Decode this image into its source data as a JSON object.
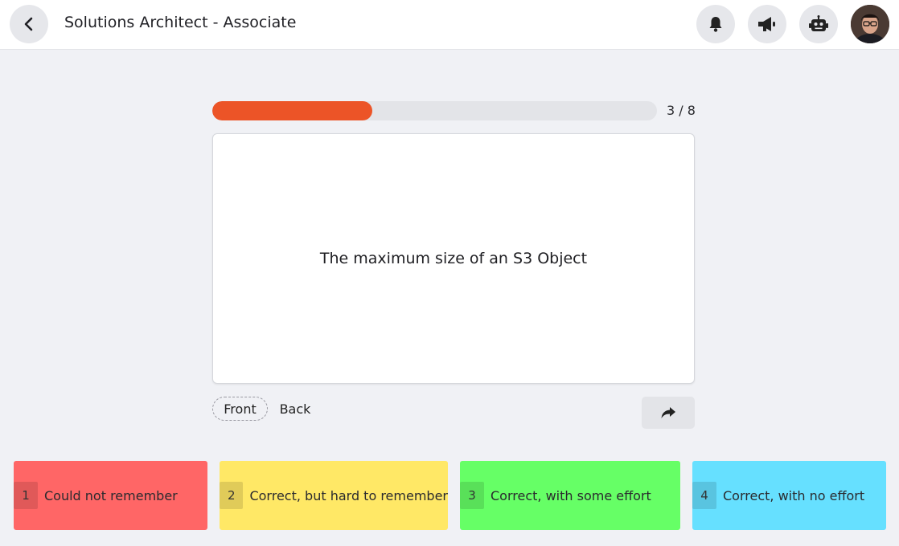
{
  "header": {
    "title": "Solutions Architect - Associate",
    "icons": [
      "back-arrow-icon",
      "bell-icon",
      "megaphone-icon",
      "robot-icon",
      "user-avatar"
    ]
  },
  "progress": {
    "current": 3,
    "total": 8,
    "label": "3 / 8",
    "fill_fraction": 0.36,
    "color": "#ec5427"
  },
  "card": {
    "text": "The maximum size of an S3 Object"
  },
  "sides": {
    "front": "Front",
    "back": "Back",
    "active": "front"
  },
  "ratings": [
    {
      "number": "1",
      "label": "Could not remember",
      "color": "#ff6666"
    },
    {
      "number": "2",
      "label": "Correct, but hard to remember",
      "color": "#ffe866"
    },
    {
      "number": "3",
      "label": "Correct, with some effort",
      "color": "#66ff66"
    },
    {
      "number": "4",
      "label": "Correct, with no effort",
      "color": "#66e0ff"
    }
  ]
}
